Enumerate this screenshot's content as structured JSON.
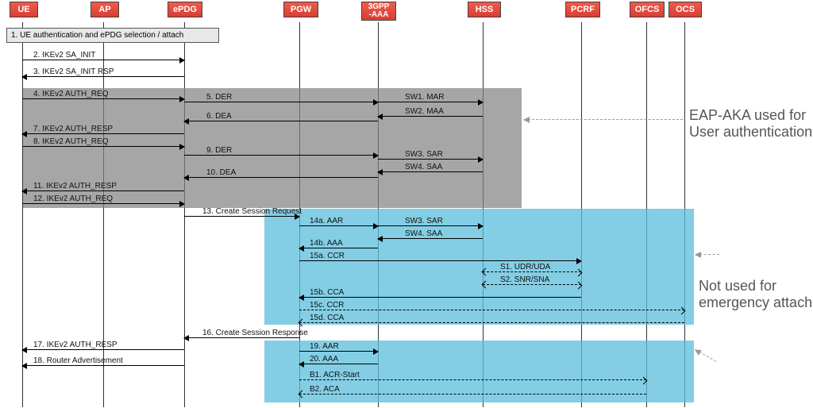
{
  "actors": [
    "UE",
    "AP",
    "ePDG",
    "PGW",
    "3GPP\n-AAA",
    "HSS",
    "PCRF",
    "OFCS",
    "OCS"
  ],
  "step1": "1. UE authentication and ePDG selection / attach",
  "messages": {
    "m2": "2. IKEv2 SA_INIT",
    "m3": "3. IKEv2 SA_INIT RSP",
    "m4": "4. IKEv2 AUTH_REQ",
    "m5": "5. DER",
    "m6": "6. DEA",
    "m7": "7. IKEv2 AUTH_RESP",
    "m8": "8. IKEv2 AUTH_REQ",
    "m9": "9. DER",
    "m10": "10. DEA",
    "m11": "11. IKEv2 AUTH_RESP",
    "m12": "12. IKEv2 AUTH_REQ",
    "m13": "13. Create Session Request",
    "m14a": "14a. AAR",
    "m14b": "14b. AAA",
    "m15a": "15a. CCR",
    "m15b": "15b. CCA",
    "m15c": "15c. CCR",
    "m15d": "15d. CCA",
    "m16": "16. Create Session Response",
    "m17": "17. IKEv2 AUTH_RESP",
    "m18": "18. Router Advertisement",
    "m19": "19. AAR",
    "m20": "20. AAA",
    "mB1": "B1. ACR-Start",
    "mB2": "B2. ACA",
    "sw1": "SW1. MAR",
    "sw2": "SW2. MAA",
    "sw3a": "SW3. SAR",
    "sw4a": "SW4. SAA",
    "sw3b": "SW3. SAR",
    "sw4b": "SW4. SAA",
    "s1": "S1. UDR/UDA",
    "s2": "S2. SNR/SNA"
  },
  "annotations": {
    "eap": "EAP-AKA used for\nUser authentication",
    "emerg": "Not used for\nemergency attach"
  },
  "positions": {
    "UE": 28,
    "AP": 130,
    "ePDG": 232,
    "PGW": 377,
    "AAA": 476,
    "HSS": 608,
    "PCRF": 732,
    "OFCS": 814,
    "OCS": 862
  }
}
